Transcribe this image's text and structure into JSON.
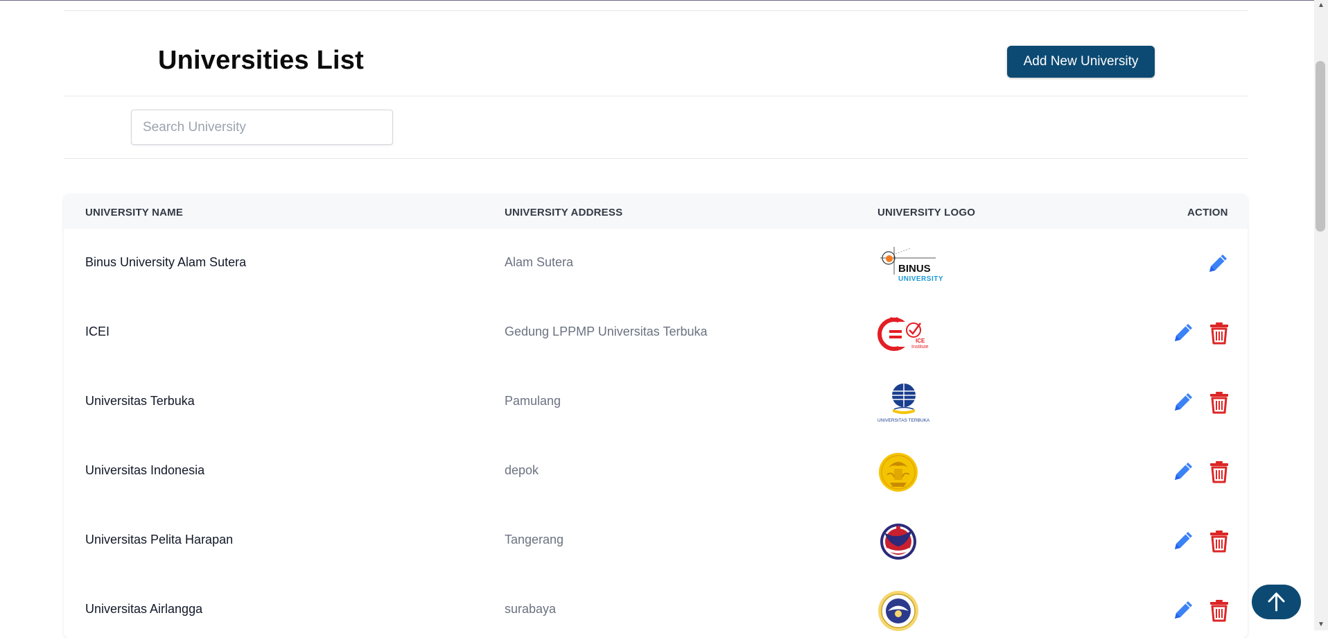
{
  "header": {
    "title": "Universities List",
    "add_button_label": "Add New University"
  },
  "search": {
    "placeholder": "Search University",
    "value": ""
  },
  "table": {
    "columns": [
      "UNIVERSITY NAME",
      "UNIVERSITY ADDRESS",
      "UNIVERSITY LOGO",
      "ACTION"
    ],
    "rows": [
      {
        "name": "Binus University Alam Sutera",
        "address": "Alam Sutera",
        "logo": "binus-logo",
        "logo_text": [
          "BINUS",
          "UNIVERSITY"
        ],
        "actions": [
          "edit"
        ]
      },
      {
        "name": "ICEI",
        "address": "Gedung LPPMP Universitas Terbuka",
        "logo": "icei-logo",
        "logo_text": [
          "ICE",
          "Institute"
        ],
        "actions": [
          "edit",
          "delete"
        ]
      },
      {
        "name": "Universitas Terbuka",
        "address": "Pamulang",
        "logo": "ut-logo",
        "logo_text": [
          "UNIVERSITAS TERBUKA"
        ],
        "actions": [
          "edit",
          "delete"
        ]
      },
      {
        "name": "Universitas Indonesia",
        "address": "depok",
        "logo": "ui-logo",
        "logo_text": [],
        "actions": [
          "edit",
          "delete"
        ]
      },
      {
        "name": "Universitas Pelita Harapan",
        "address": "Tangerang",
        "logo": "uph-logo",
        "logo_text": [],
        "actions": [
          "edit",
          "delete"
        ]
      },
      {
        "name": "Universitas Airlangga",
        "address": "surabaya",
        "logo": "unair-logo",
        "logo_text": [],
        "actions": [
          "edit",
          "delete"
        ]
      }
    ]
  },
  "colors": {
    "primary": "#0d4a73",
    "edit_icon": "#3b82f6",
    "delete_icon": "#dc2626"
  },
  "icons": {
    "edit": "pencil-icon",
    "delete": "trash-icon",
    "back_to_top": "arrow-up-icon"
  }
}
